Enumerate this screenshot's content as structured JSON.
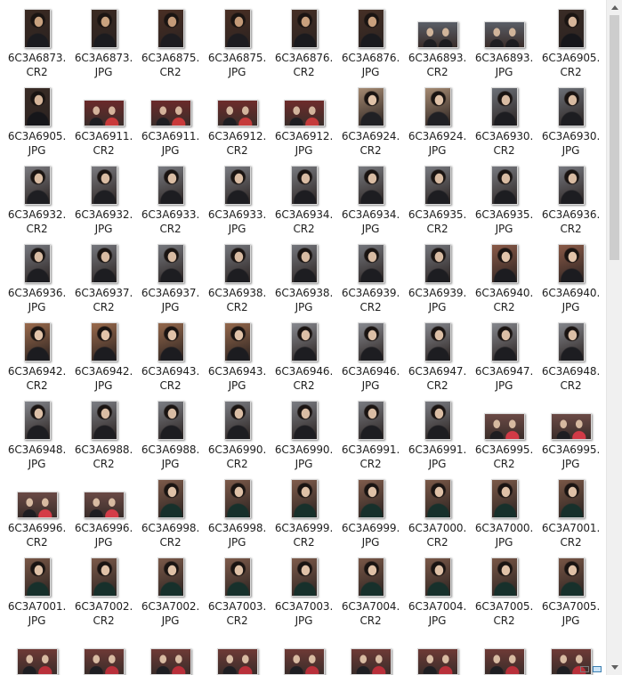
{
  "files": [
    {
      "stem": "6C3A6873.",
      "ext": "CR2",
      "orient": "portrait",
      "palette": [
        "#3b2a22",
        "#1b1b1f",
        "#c9a27f"
      ]
    },
    {
      "stem": "6C3A6873.",
      "ext": "JPG",
      "orient": "portrait",
      "palette": [
        "#3b2a22",
        "#1b1b1f",
        "#c9a27f"
      ]
    },
    {
      "stem": "6C3A6875.",
      "ext": "CR2",
      "orient": "portrait",
      "palette": [
        "#4a2f24",
        "#1d1c20",
        "#c49a78"
      ]
    },
    {
      "stem": "6C3A6875.",
      "ext": "JPG",
      "orient": "portrait",
      "palette": [
        "#4a2f24",
        "#1d1c20",
        "#c49a78"
      ]
    },
    {
      "stem": "6C3A6876.",
      "ext": "CR2",
      "orient": "portrait",
      "palette": [
        "#463026",
        "#1a1a1e",
        "#c9a07d"
      ]
    },
    {
      "stem": "6C3A6876.",
      "ext": "JPG",
      "orient": "portrait",
      "palette": [
        "#463026",
        "#1a1a1e",
        "#c9a07d"
      ]
    },
    {
      "stem": "6C3A6893.",
      "ext": "CR2",
      "orient": "landscape",
      "palette": [
        "#5a5e66",
        "#1c1c20",
        "#d0b49a"
      ]
    },
    {
      "stem": "6C3A6893.",
      "ext": "JPG",
      "orient": "landscape",
      "palette": [
        "#5a5e66",
        "#1c1c20",
        "#d0b49a"
      ]
    },
    {
      "stem": "6C3A6905.",
      "ext": "CR2",
      "orient": "portrait",
      "palette": [
        "#3a2c26",
        "#16161a",
        "#d6b59a"
      ]
    },
    {
      "stem": "6C3A6905.",
      "ext": "JPG",
      "orient": "portrait",
      "palette": [
        "#3a2c26",
        "#16161a",
        "#d6b59a"
      ]
    },
    {
      "stem": "6C3A6911.",
      "ext": "CR2",
      "orient": "landscape",
      "palette": [
        "#6b2a2a",
        "#c93a3a",
        "#d4b39b"
      ]
    },
    {
      "stem": "6C3A6911.",
      "ext": "JPG",
      "orient": "landscape",
      "palette": [
        "#6b2a2a",
        "#c93a3a",
        "#d4b39b"
      ]
    },
    {
      "stem": "6C3A6912.",
      "ext": "CR2",
      "orient": "landscape",
      "palette": [
        "#6e2c2b",
        "#c53b3b",
        "#d2b49c"
      ]
    },
    {
      "stem": "6C3A6912.",
      "ext": "JPG",
      "orient": "landscape",
      "palette": [
        "#6e2c2b",
        "#c53b3b",
        "#d2b49c"
      ]
    },
    {
      "stem": "6C3A6924.",
      "ext": "CR2",
      "orient": "portrait",
      "palette": [
        "#a58a72",
        "#202024",
        "#e0c2a8"
      ]
    },
    {
      "stem": "6C3A6924.",
      "ext": "JPG",
      "orient": "portrait",
      "palette": [
        "#a58a72",
        "#202024",
        "#e0c2a8"
      ]
    },
    {
      "stem": "6C3A6930.",
      "ext": "CR2",
      "orient": "portrait",
      "palette": [
        "#6c7077",
        "#1d1d21",
        "#d8bba2"
      ]
    },
    {
      "stem": "6C3A6930.",
      "ext": "JPG",
      "orient": "portrait",
      "palette": [
        "#6c7077",
        "#1d1d21",
        "#d8bba2"
      ]
    },
    {
      "stem": "6C3A6932.",
      "ext": "CR2",
      "orient": "portrait",
      "palette": [
        "#7b7b80",
        "#1e1e22",
        "#d9bca3"
      ]
    },
    {
      "stem": "6C3A6932.",
      "ext": "JPG",
      "orient": "portrait",
      "palette": [
        "#7b7b80",
        "#1e1e22",
        "#d9bca3"
      ]
    },
    {
      "stem": "6C3A6933.",
      "ext": "CR2",
      "orient": "portrait",
      "palette": [
        "#7a7c82",
        "#1d1d21",
        "#dabda4"
      ]
    },
    {
      "stem": "6C3A6933.",
      "ext": "JPG",
      "orient": "portrait",
      "palette": [
        "#7a7c82",
        "#1d1d21",
        "#dabda4"
      ]
    },
    {
      "stem": "6C3A6934.",
      "ext": "CR2",
      "orient": "portrait",
      "palette": [
        "#797b80",
        "#1d1d21",
        "#d9bca3"
      ]
    },
    {
      "stem": "6C3A6934.",
      "ext": "JPG",
      "orient": "portrait",
      "palette": [
        "#797b80",
        "#1d1d21",
        "#d9bca3"
      ]
    },
    {
      "stem": "6C3A6935.",
      "ext": "CR2",
      "orient": "portrait",
      "palette": [
        "#787a80",
        "#1d1d21",
        "#d8bba2"
      ]
    },
    {
      "stem": "6C3A6935.",
      "ext": "JPG",
      "orient": "portrait",
      "palette": [
        "#787a80",
        "#1d1d21",
        "#d8bba2"
      ]
    },
    {
      "stem": "6C3A6936.",
      "ext": "CR2",
      "orient": "portrait",
      "palette": [
        "#777980",
        "#1d1d21",
        "#d8bba2"
      ]
    },
    {
      "stem": "6C3A6936.",
      "ext": "JPG",
      "orient": "portrait",
      "palette": [
        "#777980",
        "#1d1d21",
        "#d8bba2"
      ]
    },
    {
      "stem": "6C3A6937.",
      "ext": "CR2",
      "orient": "portrait",
      "palette": [
        "#76787e",
        "#1d1d21",
        "#d8bba2"
      ]
    },
    {
      "stem": "6C3A6937.",
      "ext": "JPG",
      "orient": "portrait",
      "palette": [
        "#76787e",
        "#1d1d21",
        "#d8bba2"
      ]
    },
    {
      "stem": "6C3A6938.",
      "ext": "CR2",
      "orient": "portrait",
      "palette": [
        "#75777d",
        "#1d1d21",
        "#d8bba2"
      ]
    },
    {
      "stem": "6C3A6938.",
      "ext": "JPG",
      "orient": "portrait",
      "palette": [
        "#75777d",
        "#1d1d21",
        "#d8bba2"
      ]
    },
    {
      "stem": "6C3A6939.",
      "ext": "CR2",
      "orient": "portrait",
      "palette": [
        "#74767c",
        "#1d1d21",
        "#d8bba2"
      ]
    },
    {
      "stem": "6C3A6939.",
      "ext": "JPG",
      "orient": "portrait",
      "palette": [
        "#74767c",
        "#1d1d21",
        "#d8bba2"
      ]
    },
    {
      "stem": "6C3A6940.",
      "ext": "CR2",
      "orient": "portrait",
      "palette": [
        "#8a5a48",
        "#1c1c20",
        "#e2c4aa"
      ]
    },
    {
      "stem": "6C3A6940.",
      "ext": "JPG",
      "orient": "portrait",
      "palette": [
        "#8a5a48",
        "#1c1c20",
        "#e2c4aa"
      ]
    },
    {
      "stem": "6C3A6942.",
      "ext": "CR2",
      "orient": "portrait",
      "palette": [
        "#9a6a4c",
        "#1c1c20",
        "#e2c4aa"
      ]
    },
    {
      "stem": "6C3A6942.",
      "ext": "JPG",
      "orient": "portrait",
      "palette": [
        "#9a6a4c",
        "#1c1c20",
        "#e2c4aa"
      ]
    },
    {
      "stem": "6C3A6943.",
      "ext": "CR2",
      "orient": "portrait",
      "palette": [
        "#94684c",
        "#1c1c20",
        "#e1c3a9"
      ]
    },
    {
      "stem": "6C3A6943.",
      "ext": "JPG",
      "orient": "portrait",
      "palette": [
        "#94684c",
        "#1c1c20",
        "#e1c3a9"
      ]
    },
    {
      "stem": "6C3A6946.",
      "ext": "CR2",
      "orient": "portrait",
      "palette": [
        "#888a90",
        "#1d1d21",
        "#dcbfa6"
      ]
    },
    {
      "stem": "6C3A6946.",
      "ext": "JPG",
      "orient": "portrait",
      "palette": [
        "#888a90",
        "#1d1d21",
        "#dcbfa6"
      ]
    },
    {
      "stem": "6C3A6947.",
      "ext": "CR2",
      "orient": "portrait",
      "palette": [
        "#86888e",
        "#1d1d21",
        "#dcbfa6"
      ]
    },
    {
      "stem": "6C3A6947.",
      "ext": "JPG",
      "orient": "portrait",
      "palette": [
        "#86888e",
        "#1d1d21",
        "#dcbfa6"
      ]
    },
    {
      "stem": "6C3A6948.",
      "ext": "CR2",
      "orient": "portrait",
      "palette": [
        "#84868c",
        "#1d1d21",
        "#dcbfa6"
      ]
    },
    {
      "stem": "6C3A6948.",
      "ext": "JPG",
      "orient": "portrait",
      "palette": [
        "#84868c",
        "#1d1d21",
        "#dcbfa6"
      ]
    },
    {
      "stem": "6C3A6988.",
      "ext": "CR2",
      "orient": "portrait",
      "palette": [
        "#7c7e84",
        "#1d1d21",
        "#dabda4"
      ]
    },
    {
      "stem": "6C3A6988.",
      "ext": "JPG",
      "orient": "portrait",
      "palette": [
        "#7c7e84",
        "#1d1d21",
        "#dabda4"
      ]
    },
    {
      "stem": "6C3A6990.",
      "ext": "CR2",
      "orient": "portrait",
      "palette": [
        "#7b7d83",
        "#1d1d21",
        "#dabda4"
      ]
    },
    {
      "stem": "6C3A6990.",
      "ext": "JPG",
      "orient": "portrait",
      "palette": [
        "#7b7d83",
        "#1d1d21",
        "#dabda4"
      ]
    },
    {
      "stem": "6C3A6991.",
      "ext": "CR2",
      "orient": "portrait",
      "palette": [
        "#7a7c82",
        "#1d1d21",
        "#dabda4"
      ]
    },
    {
      "stem": "6C3A6991.",
      "ext": "JPG",
      "orient": "portrait",
      "palette": [
        "#7a7c82",
        "#1d1d21",
        "#dabda4"
      ]
    },
    {
      "stem": "6C3A6995.",
      "ext": "CR2",
      "orient": "landscape",
      "palette": [
        "#6b4a46",
        "#d23a46",
        "#d6b9a0"
      ]
    },
    {
      "stem": "6C3A6995.",
      "ext": "JPG",
      "orient": "landscape",
      "palette": [
        "#6b4a46",
        "#d23a46",
        "#d6b9a0"
      ]
    },
    {
      "stem": "6C3A6996.",
      "ext": "CR2",
      "orient": "landscape",
      "palette": [
        "#6a4a46",
        "#d43c48",
        "#d7baa1"
      ]
    },
    {
      "stem": "6C3A6996.",
      "ext": "JPG",
      "orient": "landscape",
      "palette": [
        "#6a4a46",
        "#d43c48",
        "#d7baa1"
      ]
    },
    {
      "stem": "6C3A6998.",
      "ext": "CR2",
      "orient": "portrait",
      "palette": [
        "#7d5a4a",
        "#17302b",
        "#dfc1a7"
      ]
    },
    {
      "stem": "6C3A6998.",
      "ext": "JPG",
      "orient": "portrait",
      "palette": [
        "#7d5a4a",
        "#17302b",
        "#dfc1a7"
      ]
    },
    {
      "stem": "6C3A6999.",
      "ext": "CR2",
      "orient": "portrait",
      "palette": [
        "#805c4c",
        "#17302b",
        "#dfc1a7"
      ]
    },
    {
      "stem": "6C3A6999.",
      "ext": "JPG",
      "orient": "portrait",
      "palette": [
        "#805c4c",
        "#17302b",
        "#dfc1a7"
      ]
    },
    {
      "stem": "6C3A7000.",
      "ext": "CR2",
      "orient": "portrait",
      "palette": [
        "#7b5948",
        "#17302b",
        "#dfc1a7"
      ]
    },
    {
      "stem": "6C3A7000.",
      "ext": "JPG",
      "orient": "portrait",
      "palette": [
        "#7b5948",
        "#17302b",
        "#dfc1a7"
      ]
    },
    {
      "stem": "6C3A7001.",
      "ext": "CR2",
      "orient": "portrait",
      "palette": [
        "#795746",
        "#17302b",
        "#dfc1a7"
      ]
    },
    {
      "stem": "6C3A7001.",
      "ext": "JPG",
      "orient": "portrait",
      "palette": [
        "#795746",
        "#17302b",
        "#dfc1a7"
      ]
    },
    {
      "stem": "6C3A7002.",
      "ext": "CR2",
      "orient": "portrait",
      "palette": [
        "#7c5a4a",
        "#17302b",
        "#dfc1a7"
      ]
    },
    {
      "stem": "6C3A7002.",
      "ext": "JPG",
      "orient": "portrait",
      "palette": [
        "#7c5a4a",
        "#17302b",
        "#dfc1a7"
      ]
    },
    {
      "stem": "6C3A7003.",
      "ext": "CR2",
      "orient": "portrait",
      "palette": [
        "#7e5b4b",
        "#17302b",
        "#dfc1a7"
      ]
    },
    {
      "stem": "6C3A7003.",
      "ext": "JPG",
      "orient": "portrait",
      "palette": [
        "#7e5b4b",
        "#17302b",
        "#dfc1a7"
      ]
    },
    {
      "stem": "6C3A7004.",
      "ext": "CR2",
      "orient": "portrait",
      "palette": [
        "#7a5848",
        "#17302b",
        "#dfc1a7"
      ]
    },
    {
      "stem": "6C3A7004.",
      "ext": "JPG",
      "orient": "portrait",
      "palette": [
        "#7a5848",
        "#17302b",
        "#dfc1a7"
      ]
    },
    {
      "stem": "6C3A7005.",
      "ext": "CR2",
      "orient": "portrait",
      "palette": [
        "#785646",
        "#17302b",
        "#dfc1a7"
      ]
    },
    {
      "stem": "6C3A7005.",
      "ext": "JPG",
      "orient": "portrait",
      "palette": [
        "#785646",
        "#17302b",
        "#dfc1a7"
      ]
    },
    {
      "stem": "",
      "ext": "",
      "orient": "landscape",
      "palette": [
        "#6e3a36",
        "#b9303a",
        "#d8bba2"
      ]
    },
    {
      "stem": "",
      "ext": "",
      "orient": "landscape",
      "palette": [
        "#6e3a36",
        "#b9303a",
        "#d8bba2"
      ]
    },
    {
      "stem": "",
      "ext": "",
      "orient": "landscape",
      "palette": [
        "#6e3a36",
        "#b9303a",
        "#d8bba2"
      ]
    },
    {
      "stem": "",
      "ext": "",
      "orient": "landscape",
      "palette": [
        "#6e3a36",
        "#b9303a",
        "#d8bba2"
      ]
    },
    {
      "stem": "",
      "ext": "",
      "orient": "landscape",
      "palette": [
        "#6e3a36",
        "#b9303a",
        "#d8bba2"
      ]
    },
    {
      "stem": "",
      "ext": "",
      "orient": "landscape",
      "palette": [
        "#6e3a36",
        "#b9303a",
        "#d8bba2"
      ]
    },
    {
      "stem": "",
      "ext": "",
      "orient": "landscape",
      "palette": [
        "#6e3a36",
        "#b9303a",
        "#d8bba2"
      ]
    },
    {
      "stem": "",
      "ext": "",
      "orient": "landscape",
      "palette": [
        "#6e3a36",
        "#b9303a",
        "#d8bba2"
      ]
    },
    {
      "stem": "",
      "ext": "",
      "orient": "landscape",
      "palette": [
        "#6e3a36",
        "#b9303a",
        "#d8bba2"
      ]
    }
  ],
  "scrollbar": {
    "position_fraction": 0.0,
    "visible_fraction": 0.38
  },
  "status_icons": [
    "details-view-icon",
    "large-icons-view-icon"
  ]
}
